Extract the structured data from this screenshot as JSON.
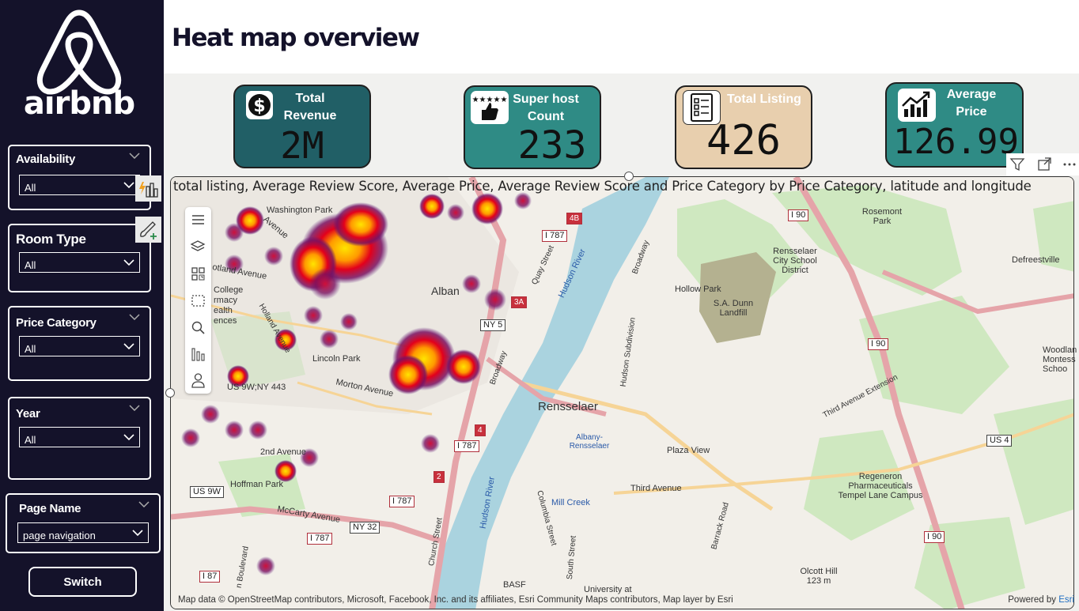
{
  "brand": {
    "name": "airbnb"
  },
  "header": {
    "title": "Heat map overview"
  },
  "slicers": [
    {
      "title": "Availability",
      "value": "All"
    },
    {
      "title": "Room Type",
      "value": "All"
    },
    {
      "title": "Price Category",
      "value": "All"
    },
    {
      "title": "Year",
      "value": "All"
    },
    {
      "title": "Page Name",
      "value": "page navigation"
    }
  ],
  "switch_button": {
    "label": "Switch"
  },
  "cards": [
    {
      "label_line1": "Total",
      "label_line2": "Revenue",
      "value": "2M",
      "icon": "dollar-icon",
      "color": "#215f66"
    },
    {
      "label_line1": "Super host",
      "label_line2": "Count",
      "value": "233",
      "icon": "superhost-stars-icon",
      "color": "#2f8b85"
    },
    {
      "label_line1": "Total Listing",
      "label_line2": "",
      "value": "426",
      "icon": "listing-checklist-icon",
      "color": "#e8cfae"
    },
    {
      "label_line1": "Average",
      "label_line2": "Price",
      "value": "126.99",
      "icon": "trend-chart-icon",
      "color": "#2f8b85"
    }
  ],
  "map": {
    "title": "total listing, Average Review Score, Average Price, Average Review Score and Price Category by Price Category, latitude and longitude",
    "attribution": "Map data © OpenStreetMap contributors, Microsoft, Facebook, Inc. and its affiliates, Esri Community Maps contributors, Map layer by Esri",
    "powered_prefix": "Powered by ",
    "powered_brand": "Esri",
    "labels": {
      "washington_park": "Washington Park",
      "avenue": "Avenue",
      "albany": "Alban",
      "lincoln_park": "Lincoln Park",
      "morton_avenue": "Morton Avenue",
      "second_avenue": "2nd Avenue",
      "hoffman_park": "Hoffman Park",
      "mccarty_avenue": "McCarty Avenue",
      "rensselaer": "Rensselaer",
      "albany_rensselaer": "Albany-Rensselaer",
      "plaza_view": "Plaza View",
      "third_avenue": "Third Avenue",
      "mill_creek": "Mill Creek",
      "hudson_river": "Hudson River",
      "hudson_subdivision": "Hudson Subdivision",
      "broadway": "Broadway",
      "rosemont_park": "Rosemont Park",
      "rensselaer_city_school": "Rensselaer City School District",
      "hollow_park": "Hollow Park",
      "sa_dunn_landfill": "S.A. Dunn Landfill",
      "defreestville": "Defreestville",
      "third_avenue_extension": "Third Avenue Extension",
      "regeneron": "Regeneron Pharmaceuticals Tempel Lane Campus",
      "olcott_hill": "Olcott Hill 123 m",
      "woodland": "Woodlan Montess Schoo",
      "barrack_road": "Barrack Road",
      "columbia_street": "Columbia Street",
      "south_street": "South Street",
      "church_street": "Church Street",
      "basf": "BASF",
      "university": "University at",
      "college": "College",
      "pharmacy": "rmacy",
      "health": "ealth",
      "sciences": "ences",
      "scotland_avenue": "otland Avenue",
      "holland_avenue": "Holland Avenue",
      "quay_street": "Quay Street",
      "s_boulevard": "n Boulevard"
    },
    "shields": {
      "i787_a": "I 787",
      "i787_b": "I 787",
      "i787_c": "I 787",
      "i787_d": "I 787",
      "i90_a": "I 90",
      "i90_b": "I 90",
      "i90_c": "I 90",
      "ny5": "NY 5",
      "ny32": "NY 32",
      "us9w": "US 9W",
      "us9w_ny443": "US 9W;NY 443",
      "us4": "US 4",
      "i87": "I 87",
      "exit_4b": "4B",
      "exit_3a": "3A",
      "exit_2": "2",
      "exit_4": "4"
    }
  }
}
